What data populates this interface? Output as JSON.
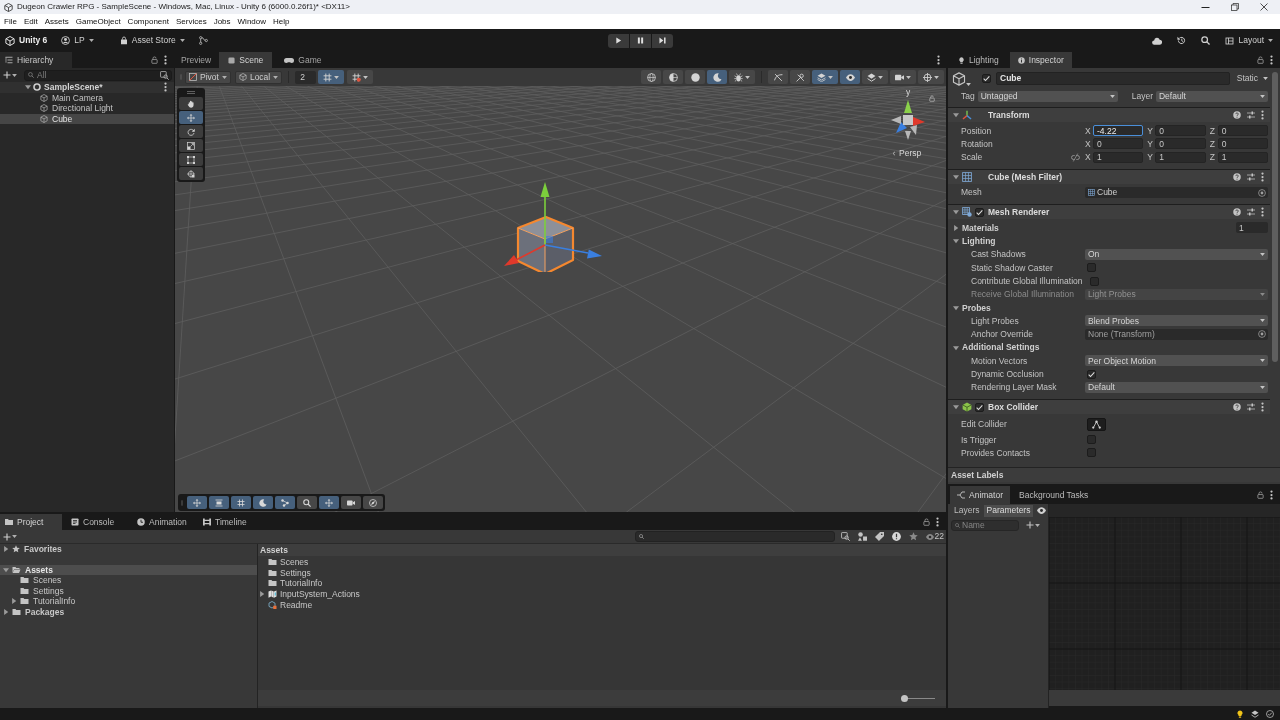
{
  "window": {
    "title": "Dugeon Crawler RPG - SampleScene - Windows, Mac, Linux - Unity 6 (6000.0.26f1)* <DX11>"
  },
  "menu_bar": [
    "File",
    "Edit",
    "Assets",
    "GameObject",
    "Component",
    "Services",
    "Jobs",
    "Window",
    "Help"
  ],
  "toolbar": {
    "product": "Unity 6",
    "account": "LP",
    "store": "Asset Store",
    "layout": "Layout"
  },
  "hierarchy": {
    "title": "Hierarchy",
    "search": {
      "placeholder": "All"
    },
    "scene": {
      "label": "SampleScene*",
      "expanded": true,
      "children": [
        {
          "label": "Main Camera",
          "selected": false
        },
        {
          "label": "Directional Light",
          "selected": false
        },
        {
          "label": "Cube",
          "selected": true
        }
      ]
    }
  },
  "scene_view": {
    "tabs": [
      {
        "label": "Preview",
        "kind": "plain",
        "selected": false
      },
      {
        "label": "Scene",
        "kind": "scene",
        "selected": true
      },
      {
        "label": "Game",
        "kind": "game",
        "selected": false
      }
    ],
    "toolbar": {
      "pivot": "Pivot",
      "space": "Local",
      "grid_size": "2",
      "snapping": [
        {
          "kind": "grid_snap",
          "selected": true
        },
        {
          "kind": "grid_visibility",
          "selected": false
        }
      ],
      "shading": [
        {
          "kind": "wireframe",
          "selected": false,
          "menu": false
        },
        {
          "kind": "shaded_wireframe",
          "selected": false,
          "menu": false
        },
        {
          "kind": "shaded",
          "selected": false,
          "menu": false
        },
        {
          "kind": "lit",
          "selected": true,
          "menu": false
        },
        {
          "kind": "debug",
          "selected": false,
          "menu": true
        }
      ],
      "view_options": [
        {
          "kind": "flat",
          "selected": false,
          "menu": false
        },
        {
          "kind": "lighting",
          "selected": false,
          "menu": false
        },
        {
          "kind": "effects",
          "selected": true,
          "menu": true
        },
        {
          "kind": "visibility",
          "selected": true,
          "menu": false
        },
        {
          "kind": "layers",
          "selected": false,
          "menu": true
        },
        {
          "kind": "camera",
          "selected": false,
          "menu": true
        },
        {
          "kind": "gizmos",
          "selected": false,
          "menu": true
        }
      ]
    },
    "tools": [
      {
        "kind": "view",
        "selected": false
      },
      {
        "kind": "move",
        "selected": true
      },
      {
        "kind": "rotate",
        "selected": false
      },
      {
        "kind": "scale",
        "selected": false
      },
      {
        "kind": "rect",
        "selected": false
      },
      {
        "kind": "transform",
        "selected": false
      }
    ],
    "gizmo_axis": "y",
    "projection": "Persp",
    "overlay": [
      {
        "kind": "move",
        "selected": true
      },
      {
        "kind": "align",
        "selected": true
      },
      {
        "kind": "grid",
        "selected": true
      },
      {
        "kind": "orbit",
        "selected": true
      },
      {
        "kind": "nodes",
        "selected": true
      },
      {
        "kind": "search",
        "selected": false
      },
      {
        "kind": "pan",
        "selected": true
      },
      {
        "kind": "camera",
        "selected": false
      },
      {
        "kind": "compass",
        "selected": false
      }
    ]
  },
  "inspector": {
    "tabs": [
      {
        "label": "Lighting",
        "kind": "lighting",
        "selected": false
      },
      {
        "label": "Inspector",
        "kind": "inspector",
        "selected": true
      }
    ],
    "object": {
      "name": "Cube",
      "active": true,
      "static": "Static",
      "tag_label": "Tag",
      "tag": "Untagged",
      "layer_label": "Layer",
      "layer": "Default"
    },
    "components": [
      {
        "kind": "transform",
        "title": "Transform",
        "expanded": true,
        "rows": [
          {
            "kind": "vector3",
            "label": "Position",
            "fields": [
              {
                "axis": "X",
                "value": "-4.22",
                "focused": true
              },
              {
                "axis": "Y",
                "value": "0",
                "focused": false
              },
              {
                "axis": "Z",
                "value": "0",
                "focused": false
              }
            ]
          },
          {
            "kind": "vector3",
            "label": "Rotation",
            "fields": [
              {
                "axis": "X",
                "value": "0",
                "focused": false
              },
              {
                "axis": "Y",
                "value": "0",
                "focused": false
              },
              {
                "axis": "Z",
                "value": "0",
                "focused": false
              }
            ]
          },
          {
            "kind": "vector3",
            "label": "Scale",
            "constrain_proportions": false,
            "fields": [
              {
                "axis": "X",
                "value": "1",
                "focused": false
              },
              {
                "axis": "Y",
                "value": "1",
                "focused": false
              },
              {
                "axis": "Z",
                "value": "1",
                "focused": false
              }
            ]
          }
        ]
      },
      {
        "kind": "mesh_filter",
        "title": "Cube (Mesh Filter)",
        "expanded": true,
        "rows": [
          {
            "kind": "object",
            "label": "Mesh",
            "value": "Cube",
            "assigned": true
          }
        ]
      },
      {
        "kind": "mesh_renderer",
        "title": "Mesh Renderer",
        "enabled": true,
        "expanded": true,
        "rows": [
          {
            "kind": "group",
            "label": "Materials",
            "expanded": false,
            "value": "1"
          },
          {
            "kind": "group",
            "label": "Lighting",
            "expanded": true,
            "children": [
              {
                "kind": "dropdown",
                "label": "Cast Shadows",
                "value": "On",
                "disabled": false
              },
              {
                "kind": "checkbox",
                "label": "Static Shadow Caster",
                "checked": false,
                "disabled": false
              },
              {
                "kind": "checkbox",
                "label": "Contribute Global Illumination",
                "checked": false,
                "disabled": false
              },
              {
                "kind": "dropdown",
                "label": "Receive Global Illumination",
                "value": "Light Probes",
                "disabled": true
              }
            ]
          },
          {
            "kind": "group",
            "label": "Probes",
            "expanded": true,
            "children": [
              {
                "kind": "dropdown",
                "label": "Light Probes",
                "value": "Blend Probes"
              },
              {
                "kind": "object",
                "label": "Anchor Override",
                "value": "None (Transform)",
                "assigned": false
              }
            ]
          },
          {
            "kind": "group",
            "label": "Additional Settings",
            "expanded": true,
            "children": [
              {
                "kind": "dropdown",
                "label": "Motion Vectors",
                "value": "Per Object Motion"
              },
              {
                "kind": "checkbox",
                "label": "Dynamic Occlusion",
                "checked": true
              },
              {
                "kind": "dropdown",
                "label": "Rendering Layer Mask",
                "value": "Default"
              }
            ]
          }
        ]
      },
      {
        "kind": "box_collider",
        "title": "Box Collider",
        "enabled": true,
        "expanded": true,
        "rows": [
          {
            "kind": "button",
            "label": "Edit Collider"
          },
          {
            "kind": "checkbox",
            "label": "Is Trigger",
            "checked": false
          },
          {
            "kind": "checkbox",
            "label": "Provides Contacts",
            "checked": false
          }
        ]
      }
    ],
    "asset_labels": "Asset Labels"
  },
  "project": {
    "tabs": [
      {
        "label": "Project",
        "kind": "project",
        "selected": true
      },
      {
        "label": "Console",
        "kind": "console",
        "selected": false
      },
      {
        "label": "Animation",
        "kind": "animation",
        "selected": false
      },
      {
        "label": "Timeline",
        "kind": "timeline",
        "selected": false
      }
    ],
    "hidden_count": "22",
    "tree": [
      {
        "label": "Favorites",
        "kind": "favorites",
        "expanded": false,
        "selected": false
      },
      {
        "label": "Assets",
        "kind": "folder",
        "expanded": true,
        "selected": true,
        "children": [
          {
            "label": "Scenes",
            "kind": "folder",
            "selected": false
          },
          {
            "label": "Settings",
            "kind": "folder",
            "selected": false
          },
          {
            "label": "TutorialInfo",
            "kind": "folder",
            "expanded": false,
            "selected": false
          }
        ]
      },
      {
        "label": "Packages",
        "kind": "folder",
        "expanded": false,
        "selected": false
      }
    ],
    "path": "Assets",
    "items": [
      {
        "label": "Scenes",
        "kind": "folder"
      },
      {
        "label": "Settings",
        "kind": "folder"
      },
      {
        "label": "TutorialInfo",
        "kind": "folder"
      },
      {
        "label": "InputSystem_Actions",
        "kind": "input_actions",
        "expanded": false
      },
      {
        "label": "Readme",
        "kind": "readme"
      }
    ],
    "zoom": {
      "level": 0
    }
  },
  "animator": {
    "tabs": [
      {
        "label": "Animator",
        "kind": "animator",
        "selected": true
      },
      {
        "label": "Background Tasks",
        "kind": "plain",
        "selected": false
      }
    ],
    "sections": [
      {
        "label": "Layers",
        "selected": false
      },
      {
        "label": "Parameters",
        "selected": true
      }
    ],
    "search": {
      "placeholder": "Name"
    }
  }
}
